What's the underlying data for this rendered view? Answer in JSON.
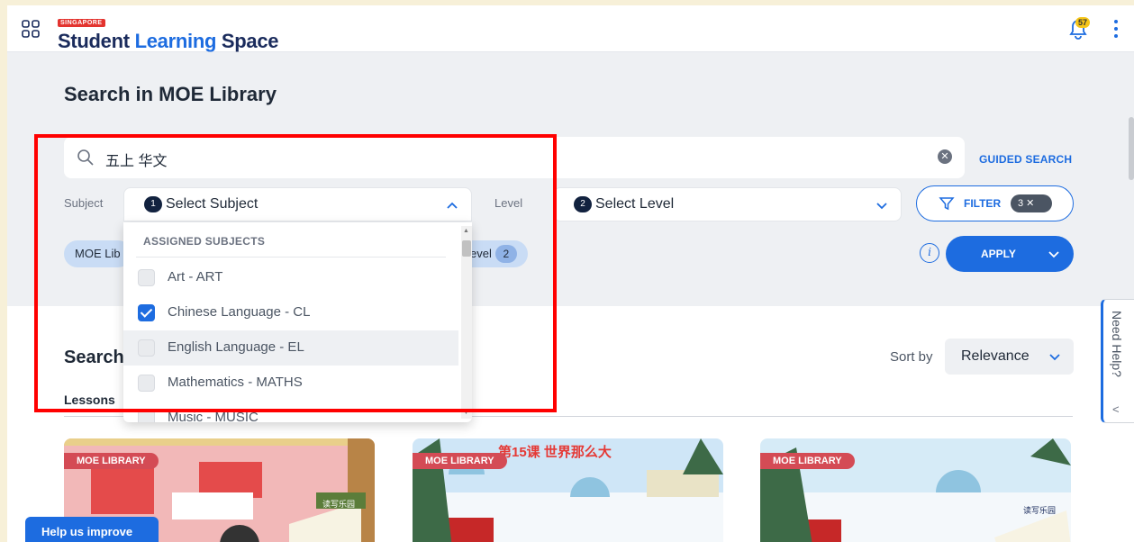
{
  "header": {
    "brand_tag": "SINGAPORE",
    "brand_part1": "Student",
    "brand_part2": "Learning",
    "brand_part3": "Space",
    "notification_count": "57"
  },
  "page": {
    "title": "Search in MOE Library"
  },
  "search": {
    "value": "五上 华文",
    "guided_label": "GUIDED SEARCH"
  },
  "filters": {
    "subject_label": "Subject",
    "subject_badge": "1",
    "subject_placeholder": "Select Subject",
    "level_label": "Level",
    "level_badge": "2",
    "level_placeholder": "Select Level",
    "filter_label": "FILTER",
    "filter_count": "3 ✕",
    "apply_label": "APPLY"
  },
  "chips": [
    {
      "label": "MOE Lib"
    },
    {
      "label": "evel",
      "count": "2"
    }
  ],
  "dropdown": {
    "header": "ASSIGNED SUBJECTS",
    "items": [
      {
        "label": "Art - ART",
        "checked": false
      },
      {
        "label": "Chinese Language - CL",
        "checked": true
      },
      {
        "label": "English Language - EL",
        "checked": false
      },
      {
        "label": "Mathematics - MATHS",
        "checked": false
      },
      {
        "label": "Music - MUSIC",
        "checked": false
      }
    ]
  },
  "results": {
    "title": "Search",
    "tab": "Lessons",
    "sort_label": "Sort by",
    "sort_value": "Relevance",
    "card_tag": "MOE LIBRARY",
    "card2_title": "第15课 世界那么大",
    "card1_caption": "读写乐园",
    "card3_caption": "读写乐园"
  },
  "widgets": {
    "help_improve": "Help us improve",
    "need_help": "Need Help?"
  },
  "colors": {
    "accent": "#1d6ce0",
    "brand_navy": "#1a2b5c",
    "tag_red": "#d44b55",
    "highlight_box": "#ff0000"
  }
}
